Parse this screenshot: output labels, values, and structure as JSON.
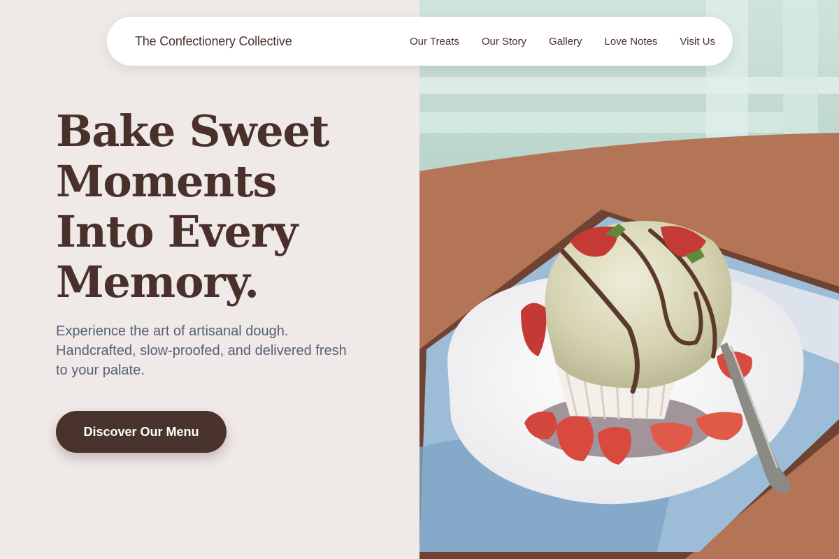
{
  "nav": {
    "brand": "The Confectionery Collective",
    "links": [
      "Our Treats",
      "Our Story",
      "Gallery",
      "Love Notes",
      "Visit Us"
    ]
  },
  "hero": {
    "headline_lines": [
      "Bake Sweet",
      "Moments",
      "Into Every",
      "Memory."
    ],
    "subtext": "Experience the art of artisanal dough. Handcrafted, slow-proofed, and delivered fresh to your palate.",
    "cta_label": "Discover Our Menu"
  },
  "photo": {
    "subject": "ice-cream-dessert-with-strawberries"
  },
  "colors": {
    "background": "#efe9e8",
    "brand_brown": "#4a302b",
    "subtext": "#556174",
    "button": "#4a322d"
  }
}
